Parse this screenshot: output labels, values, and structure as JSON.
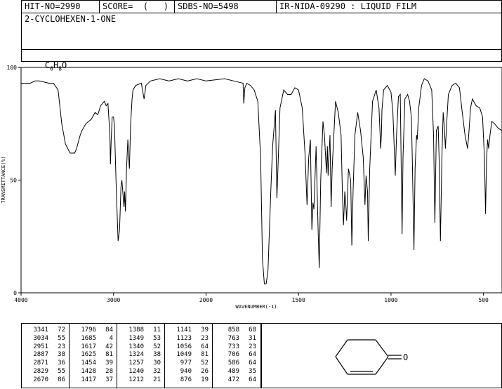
{
  "header": {
    "hit_no": "HIT-NO=2990",
    "score": "SCORE=  (   )",
    "sdbs_no": "SDBS-NO=5498",
    "ir_nida": "IR-NIDA-09290 : LIQUID FILM",
    "compound_name": "2-CYCLOHEXEN-1-ONE",
    "formula": {
      "c": "C",
      "c_sub": "6",
      "h": "H",
      "h_sub": "8",
      "o": "O"
    }
  },
  "chart_data": {
    "type": "line",
    "xlabel": "WAVENUMBER(-1)",
    "ylabel": "TRANSMITTANCE(%)",
    "xlim": [
      4000,
      400
    ],
    "ylim": [
      0,
      100
    ],
    "xticks": [
      "4000",
      "3000",
      "2000",
      "1500",
      "1000",
      "500"
    ],
    "yticks": [
      "100",
      "50",
      "0"
    ],
    "spectrum": [
      [
        4000,
        93
      ],
      [
        3900,
        93
      ],
      [
        3850,
        94
      ],
      [
        3800,
        94
      ],
      [
        3700,
        93
      ],
      [
        3650,
        93
      ],
      [
        3600,
        90
      ],
      [
        3560,
        75
      ],
      [
        3520,
        66
      ],
      [
        3470,
        62
      ],
      [
        3420,
        62
      ],
      [
        3400,
        64
      ],
      [
        3360,
        70
      ],
      [
        3341,
        72
      ],
      [
        3300,
        75
      ],
      [
        3240,
        77
      ],
      [
        3200,
        80
      ],
      [
        3170,
        79
      ],
      [
        3140,
        83
      ],
      [
        3100,
        85
      ],
      [
        3080,
        83
      ],
      [
        3060,
        84
      ],
      [
        3040,
        70
      ],
      [
        3034,
        57
      ],
      [
        3025,
        68
      ],
      [
        3015,
        78
      ],
      [
        3000,
        78
      ],
      [
        2990,
        74
      ],
      [
        2970,
        45
      ],
      [
        2951,
        23
      ],
      [
        2935,
        28
      ],
      [
        2920,
        47
      ],
      [
        2910,
        50
      ],
      [
        2887,
        38
      ],
      [
        2880,
        45
      ],
      [
        2871,
        36
      ],
      [
        2860,
        55
      ],
      [
        2845,
        68
      ],
      [
        2829,
        55
      ],
      [
        2815,
        75
      ],
      [
        2800,
        86
      ],
      [
        2790,
        90
      ],
      [
        2760,
        92
      ],
      [
        2700,
        93
      ],
      [
        2670,
        86
      ],
      [
        2650,
        92
      ],
      [
        2600,
        94
      ],
      [
        2500,
        95
      ],
      [
        2400,
        94
      ],
      [
        2300,
        95
      ],
      [
        2200,
        94
      ],
      [
        2100,
        95
      ],
      [
        2000,
        94
      ],
      [
        1900,
        95
      ],
      [
        1850,
        94
      ],
      [
        1800,
        93
      ],
      [
        1796,
        84
      ],
      [
        1790,
        91
      ],
      [
        1780,
        93
      ],
      [
        1760,
        92
      ],
      [
        1740,
        90
      ],
      [
        1720,
        85
      ],
      [
        1705,
        60
      ],
      [
        1695,
        15
      ],
      [
        1685,
        4
      ],
      [
        1675,
        4
      ],
      [
        1665,
        10
      ],
      [
        1650,
        45
      ],
      [
        1640,
        65
      ],
      [
        1625,
        81
      ],
      [
        1617,
        42
      ],
      [
        1610,
        58
      ],
      [
        1600,
        82
      ],
      [
        1580,
        90
      ],
      [
        1560,
        88
      ],
      [
        1540,
        88
      ],
      [
        1520,
        91
      ],
      [
        1500,
        90
      ],
      [
        1480,
        82
      ],
      [
        1465,
        62
      ],
      [
        1454,
        39
      ],
      [
        1445,
        60
      ],
      [
        1436,
        68
      ],
      [
        1428,
        28
      ],
      [
        1422,
        40
      ],
      [
        1417,
        37
      ],
      [
        1405,
        65
      ],
      [
        1395,
        30
      ],
      [
        1388,
        11
      ],
      [
        1380,
        50
      ],
      [
        1368,
        76
      ],
      [
        1360,
        70
      ],
      [
        1349,
        53
      ],
      [
        1344,
        65
      ],
      [
        1340,
        52
      ],
      [
        1330,
        70
      ],
      [
        1324,
        38
      ],
      [
        1318,
        55
      ],
      [
        1300,
        85
      ],
      [
        1285,
        80
      ],
      [
        1270,
        70
      ],
      [
        1263,
        45
      ],
      [
        1257,
        30
      ],
      [
        1250,
        45
      ],
      [
        1245,
        40
      ],
      [
        1240,
        32
      ],
      [
        1230,
        55
      ],
      [
        1218,
        50
      ],
      [
        1212,
        21
      ],
      [
        1205,
        45
      ],
      [
        1195,
        70
      ],
      [
        1180,
        80
      ],
      [
        1165,
        72
      ],
      [
        1150,
        60
      ],
      [
        1141,
        39
      ],
      [
        1135,
        52
      ],
      [
        1127,
        45
      ],
      [
        1123,
        23
      ],
      [
        1115,
        55
      ],
      [
        1100,
        85
      ],
      [
        1080,
        90
      ],
      [
        1065,
        82
      ],
      [
        1056,
        64
      ],
      [
        1052,
        70
      ],
      [
        1049,
        81
      ],
      [
        1040,
        90
      ],
      [
        1020,
        92
      ],
      [
        1000,
        89
      ],
      [
        990,
        80
      ],
      [
        977,
        52
      ],
      [
        970,
        70
      ],
      [
        960,
        87
      ],
      [
        950,
        88
      ],
      [
        940,
        26
      ],
      [
        935,
        60
      ],
      [
        925,
        86
      ],
      [
        910,
        88
      ],
      [
        900,
        85
      ],
      [
        890,
        78
      ],
      [
        885,
        60
      ],
      [
        876,
        19
      ],
      [
        870,
        55
      ],
      [
        862,
        70
      ],
      [
        858,
        68
      ],
      [
        850,
        82
      ],
      [
        835,
        92
      ],
      [
        820,
        95
      ],
      [
        800,
        94
      ],
      [
        780,
        90
      ],
      [
        770,
        70
      ],
      [
        763,
        31
      ],
      [
        755,
        72
      ],
      [
        745,
        74
      ],
      [
        740,
        60
      ],
      [
        733,
        23
      ],
      [
        725,
        60
      ],
      [
        718,
        80
      ],
      [
        712,
        74
      ],
      [
        706,
        64
      ],
      [
        700,
        74
      ],
      [
        690,
        88
      ],
      [
        670,
        92
      ],
      [
        650,
        93
      ],
      [
        630,
        91
      ],
      [
        615,
        80
      ],
      [
        600,
        70
      ],
      [
        586,
        64
      ],
      [
        580,
        70
      ],
      [
        570,
        82
      ],
      [
        560,
        86
      ],
      [
        540,
        83
      ],
      [
        520,
        82
      ],
      [
        505,
        78
      ],
      [
        495,
        60
      ],
      [
        489,
        35
      ],
      [
        484,
        58
      ],
      [
        478,
        68
      ],
      [
        472,
        64
      ],
      [
        465,
        70
      ],
      [
        455,
        76
      ],
      [
        440,
        75
      ],
      [
        420,
        73
      ],
      [
        400,
        72
      ]
    ]
  },
  "peaks": {
    "col1": [
      [
        "3341",
        "72"
      ],
      [
        "3034",
        "55"
      ],
      [
        "2951",
        "23"
      ],
      [
        "2887",
        "38"
      ],
      [
        "2871",
        "36"
      ],
      [
        "2829",
        "55"
      ],
      [
        "2670",
        "86"
      ]
    ],
    "col2": [
      [
        "1796",
        "84"
      ],
      [
        "1685",
        "4"
      ],
      [
        "1617",
        "42"
      ],
      [
        "1625",
        "81"
      ],
      [
        "1454",
        "39"
      ],
      [
        "1428",
        "28"
      ],
      [
        "1417",
        "37"
      ]
    ],
    "col3": [
      [
        "1388",
        "11"
      ],
      [
        "1349",
        "53"
      ],
      [
        "1340",
        "52"
      ],
      [
        "1324",
        "38"
      ],
      [
        "1257",
        "30"
      ],
      [
        "1240",
        "32"
      ],
      [
        "1212",
        "21"
      ]
    ],
    "col4": [
      [
        "1141",
        "39"
      ],
      [
        "1123",
        "23"
      ],
      [
        "1056",
        "64"
      ],
      [
        "1049",
        "81"
      ],
      [
        "977",
        "52"
      ],
      [
        "940",
        "26"
      ],
      [
        "876",
        "19"
      ]
    ],
    "col5": [
      [
        "858",
        "68"
      ],
      [
        "763",
        "31"
      ],
      [
        "733",
        "23"
      ],
      [
        "706",
        "64"
      ],
      [
        "586",
        "64"
      ],
      [
        "489",
        "35"
      ],
      [
        "472",
        "64"
      ]
    ]
  },
  "structure": {
    "atom_label": "O"
  }
}
